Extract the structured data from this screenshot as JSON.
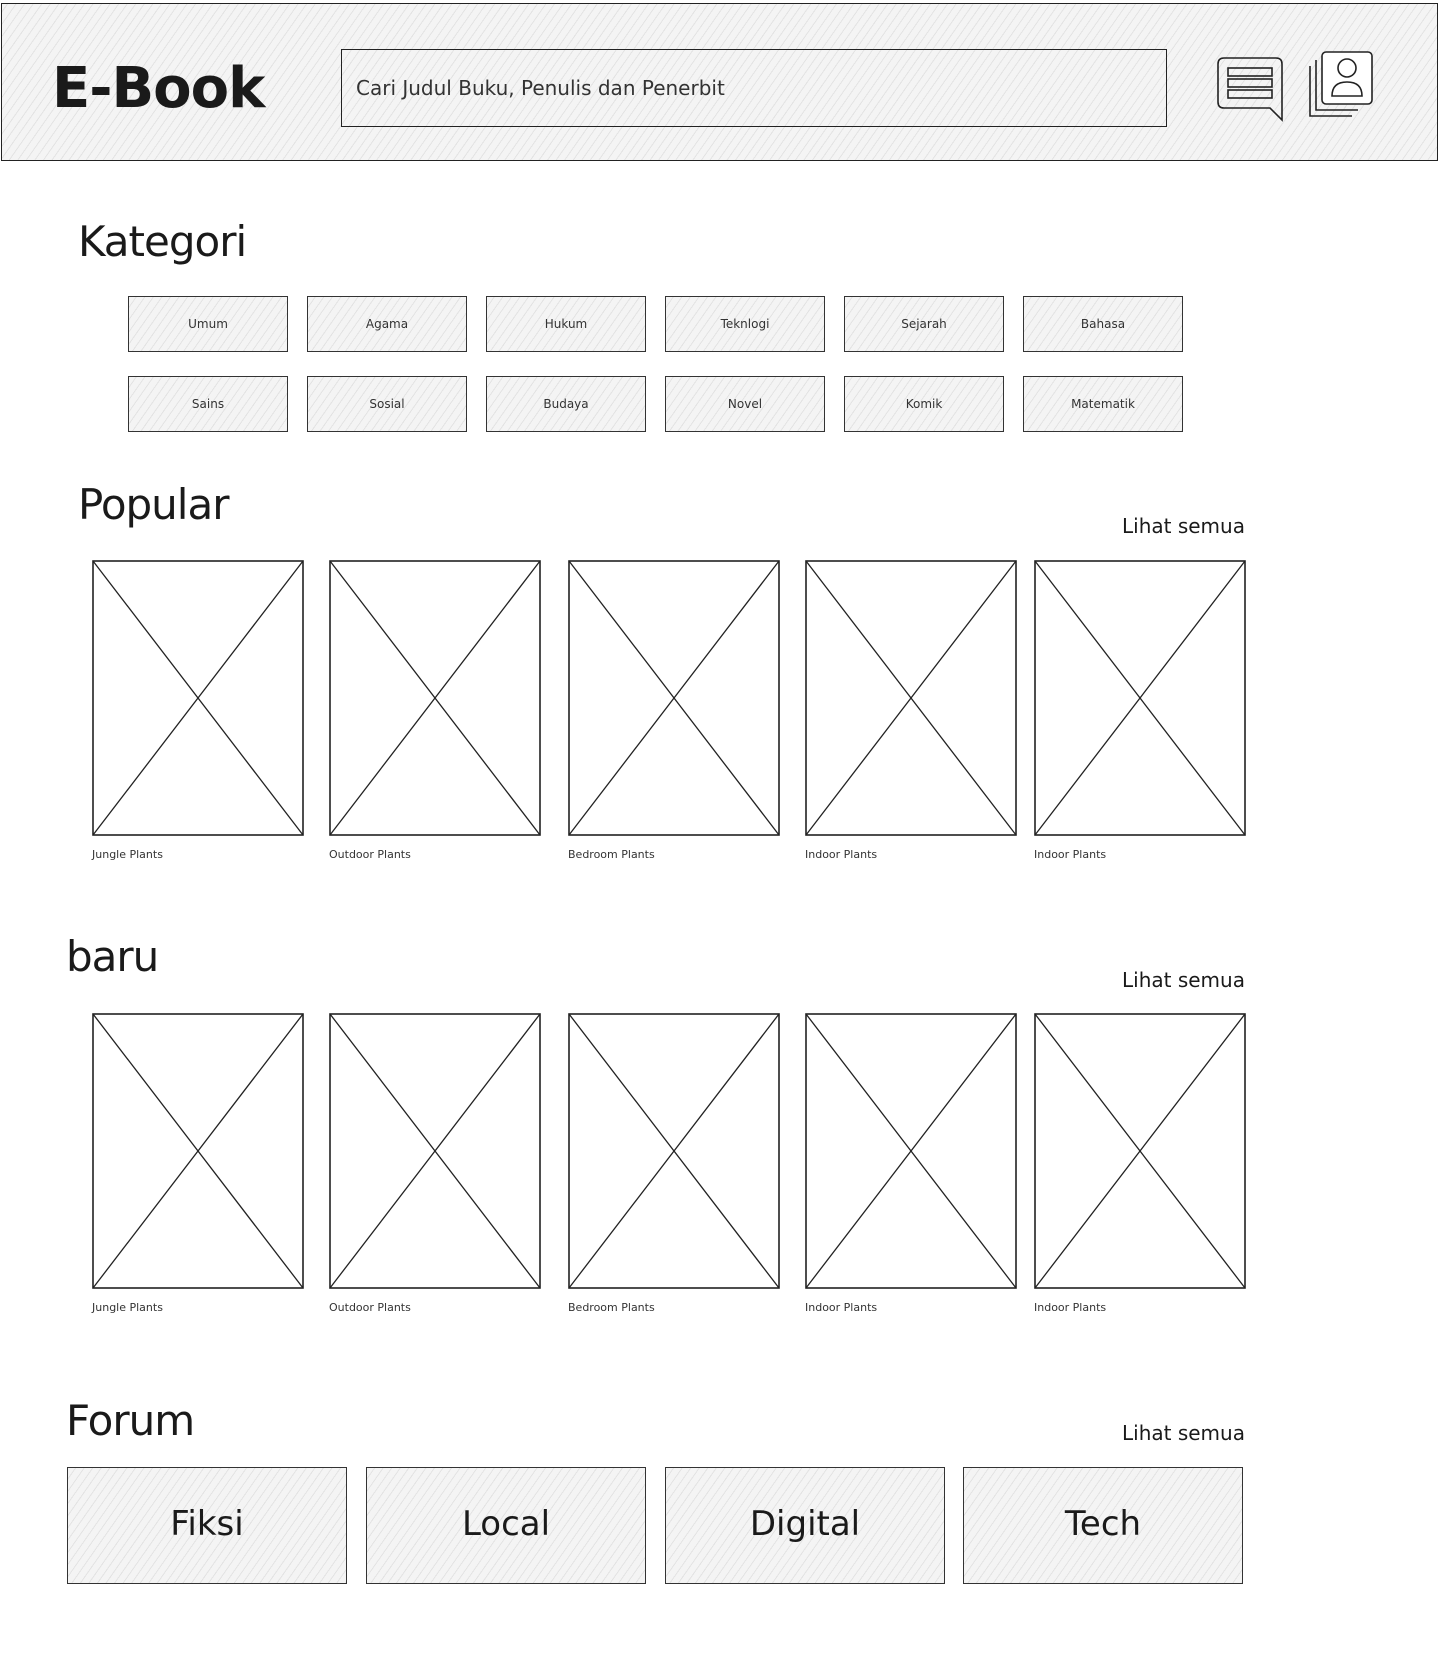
{
  "header": {
    "logo": "E-Book",
    "search_placeholder": "Cari Judul Buku, Penulis dan Penerbit"
  },
  "kategori": {
    "title": "Kategori",
    "items": [
      "Umum",
      "Agama",
      "Hukum",
      "Teknlogi",
      "Sejarah",
      "Bahasa",
      "Sains",
      "Sosial",
      "Budaya",
      "Novel",
      "Komik",
      "Matematik"
    ]
  },
  "popular": {
    "title": "Popular",
    "see_all": "Lihat semua",
    "books": [
      {
        "label": "Jungle Plants"
      },
      {
        "label": "Outdoor Plants"
      },
      {
        "label": "Bedroom Plants"
      },
      {
        "label": "Indoor Plants"
      },
      {
        "label": "Indoor Plants"
      }
    ]
  },
  "baru": {
    "title": "baru",
    "see_all": "Lihat semua",
    "books": [
      {
        "label": "Jungle Plants"
      },
      {
        "label": "Outdoor Plants"
      },
      {
        "label": "Bedroom Plants"
      },
      {
        "label": "Indoor Plants"
      },
      {
        "label": "Indoor Plants"
      }
    ]
  },
  "forum": {
    "title": "Forum",
    "see_all": "Lihat semua",
    "items": [
      "Fiksi",
      "Local",
      "Digital",
      "Tech"
    ]
  }
}
